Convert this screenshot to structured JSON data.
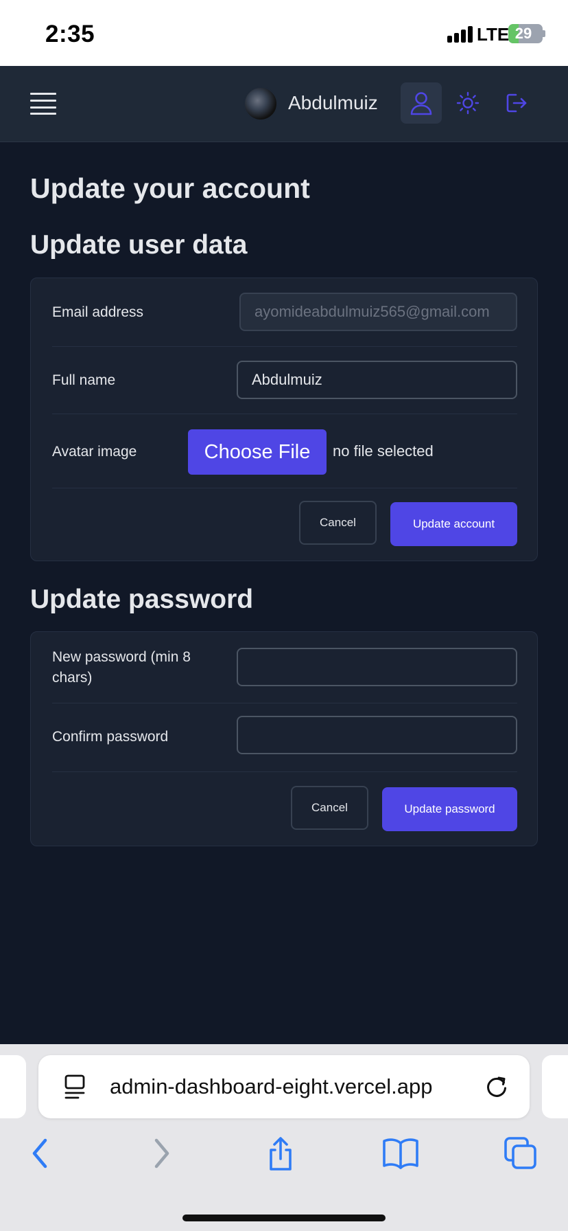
{
  "status_bar": {
    "time": "2:35",
    "network": "LTE",
    "battery_percent": "29",
    "battery_level": 0.29
  },
  "header": {
    "user_name": "Abdulmuiz",
    "icons": [
      "menu-icon",
      "avatar",
      "user-icon",
      "sun-icon",
      "logout-icon"
    ],
    "accent_color": "#4f46e5"
  },
  "page": {
    "title": "Update your account",
    "user_section": {
      "title": "Update user data",
      "email_label": "Email address",
      "email_value": "ayomideabdulmuiz565@gmail.com",
      "fullname_label": "Full name",
      "fullname_value": "Abdulmuiz",
      "avatar_label": "Avatar image",
      "choose_file_label": "Choose File",
      "file_status": "no file selected",
      "cancel_label": "Cancel",
      "submit_label": "Update account"
    },
    "password_section": {
      "title": "Update password",
      "new_password_label": "New password (min 8 chars)",
      "new_password_value": "",
      "confirm_password_label": "Confirm password",
      "confirm_password_value": "",
      "cancel_label": "Cancel",
      "submit_label": "Update password"
    }
  },
  "browser": {
    "url": "admin-dashboard-eight.vercel.app",
    "toolbar_icons": [
      "back-icon",
      "forward-icon",
      "share-icon",
      "bookmarks-icon",
      "tabs-icon"
    ]
  }
}
